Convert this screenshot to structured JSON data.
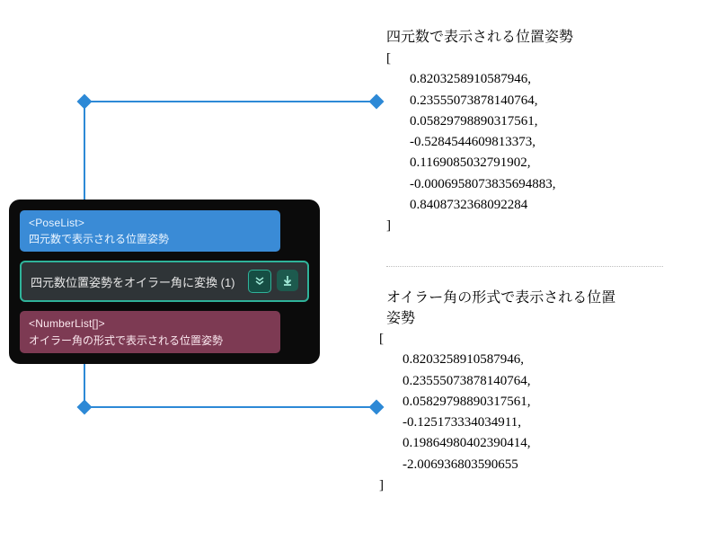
{
  "node": {
    "input": {
      "tag": "<PoseList>",
      "desc": "四元数で表示される位置姿勢"
    },
    "title": "四元数位置姿勢をオイラー角に変換 (1)",
    "output": {
      "tag": "<NumberList[]>",
      "desc": "オイラー角の形式で表示される位置姿勢"
    }
  },
  "quaternion": {
    "title": "四元数で表示される位置姿勢",
    "open": "[",
    "close": "]",
    "values": [
      "0.8203258910587946,",
      "0.23555073878140764,",
      "0.05829798890317561,",
      "-0.5284544609813373,",
      "0.1169085032791902,",
      "-0.0006958073835694883,",
      "0.8408732368092284"
    ]
  },
  "euler": {
    "title": "オイラー角の形式で表示される位置姿勢",
    "open": "[",
    "close": "]",
    "values": [
      "0.8203258910587946,",
      "0.23555073878140764,",
      "0.05829798890317561,",
      "-0.125173334034911,",
      "0.19864980402390414,",
      "-2.006936803590655"
    ]
  },
  "style": {
    "accent": "#2d89d6"
  }
}
